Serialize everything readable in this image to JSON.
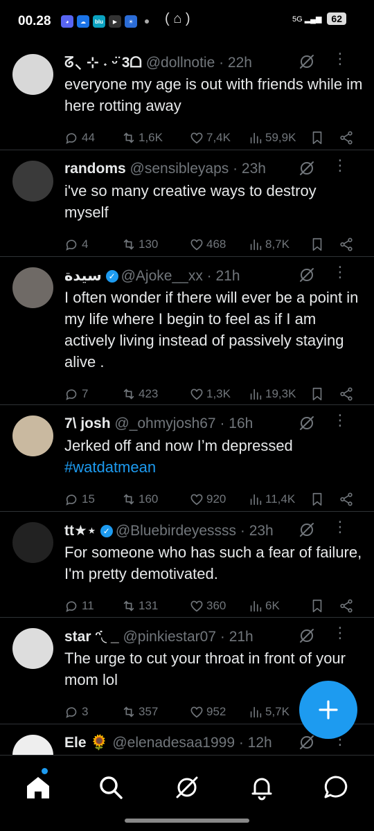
{
  "status": {
    "time": "00.28",
    "network": "5G",
    "battery": "62"
  },
  "tweets": [
    {
      "name": "ᘔ⸜ ⊹ ˖ ᵕ̈ 3ᗝ",
      "handle": "@dollnotie · 22h",
      "verified": false,
      "text": "everyone my age is out with friends while im here rotting away",
      "hashtag": "",
      "replies": "44",
      "retweets": "1,6K",
      "likes": "7,4K",
      "views": "59,9K"
    },
    {
      "name": "randoms",
      "handle": "@sensibleyaps · 23h",
      "verified": false,
      "text": "i've so many creative ways to destroy myself",
      "hashtag": "",
      "replies": "4",
      "retweets": "130",
      "likes": "468",
      "views": "8,7K"
    },
    {
      "name": "سيدة",
      "handle": "@Ajoke__xx · 21h",
      "verified": true,
      "text": "I often wonder if there will ever be a point in my life where I begin to feel as if I am actively living instead of passively staying alive .",
      "hashtag": "",
      "replies": "7",
      "retweets": "423",
      "likes": "1,3K",
      "views": "19,3K"
    },
    {
      "name": "7\\ josh",
      "handle": "@_ohmyjosh67 · 16h",
      "verified": false,
      "text": "Jerked off and now I’m depressed",
      "hashtag": "#watdatmean",
      "replies": "15",
      "retweets": "160",
      "likes": "920",
      "views": "11,4K"
    },
    {
      "name": "tt★⋆",
      "handle": "@Bluebirdeyessss · 23h",
      "verified": true,
      "text": "For someone who has such a fear of failure, I'm pretty demotivated.",
      "hashtag": "",
      "replies": "11",
      "retweets": "131",
      "likes": "360",
      "views": "6K"
    },
    {
      "name": "star ᵔ̇◟ _",
      "handle": "@pinkiestar07 · 21h",
      "verified": false,
      "text": "The urge to cut your throat in front of your mom lol",
      "hashtag": "",
      "replies": "3",
      "retweets": "357",
      "likes": "952",
      "views": "5,7K"
    },
    {
      "name": "Ele 🌻",
      "handle": "@elenadesaa1999 · 12h",
      "verified": false,
      "text": "",
      "hashtag": "",
      "replies": "",
      "retweets": "",
      "likes": "",
      "views": ""
    }
  ],
  "nav": [
    "home-icon",
    "search-icon",
    "grok-icon",
    "notifications-icon",
    "messages-icon"
  ],
  "colors": {
    "accent": "#1d9bf0",
    "muted": "#71767b",
    "background": "#000000"
  }
}
